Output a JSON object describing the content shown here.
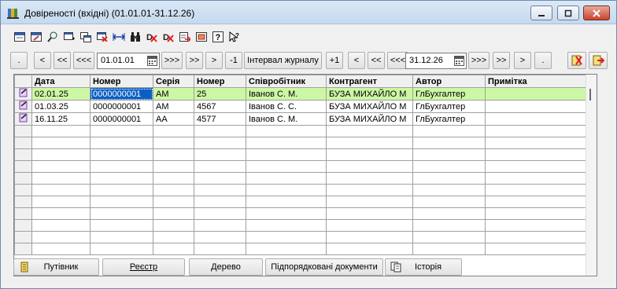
{
  "window": {
    "title": "Довіреності (вхідні) (01.01.01-31.12.26)"
  },
  "toolbar": {
    "icons": [
      "add-doc-icon",
      "edit-doc-icon",
      "view-doc-icon",
      "add-row-icon",
      "copy-doc-icon",
      "delete-doc-icon",
      "width-icon",
      "binoculars-icon",
      "delete-red-icon",
      "delete-red2-icon",
      "export-icon",
      "print-icon",
      "help-icon",
      "context-help-icon"
    ]
  },
  "nav": {
    "dot_left": ".",
    "prev": "<",
    "prev2": "<<",
    "prev3": "<<<",
    "date_from": "01.01.01",
    "next3": ">>>",
    "next2": ">>",
    "next": ">",
    "minus1": "-1",
    "interval": "Інтервал журналу",
    "plus1": "+1",
    "r_prev": "<",
    "r_prev2": "<<",
    "r_prev3": "<<<",
    "date_to": "31.12.26",
    "r_next3": ">>>",
    "r_next2": ">>",
    "r_next": ">",
    "dot_right": "."
  },
  "table": {
    "headers": [
      "Дата",
      "Номер",
      "Серія",
      "Номер",
      "Співробітник",
      "Контрагент",
      "Автор",
      "Примітка"
    ],
    "rows": [
      [
        "02.01.25",
        "0000000001",
        "АМ",
        "25",
        "Іванов С. М.",
        "БУЗА МИХАЙЛО М",
        "ГлБухгалтер",
        ""
      ],
      [
        "01.03.25",
        "0000000001",
        "АМ",
        "4567",
        "Іванов С. С.",
        "БУЗА МИХАЙЛО М",
        "ГлБухгалтер",
        ""
      ],
      [
        "16.11.25",
        "0000000001",
        "АА",
        "4577",
        "Іванов С. М.",
        "БУЗА МИХАЙЛО М",
        "ГлБухгалтер",
        ""
      ]
    ]
  },
  "bottom": {
    "guide": "Путівник",
    "registry": "Реєстр",
    "tree": "Дерево",
    "subdocs": "Підпорядковані документи",
    "history": "Історія"
  },
  "colors": {
    "selected_row": "#ccf7a4",
    "focus_cell": "#0a5fc2"
  }
}
